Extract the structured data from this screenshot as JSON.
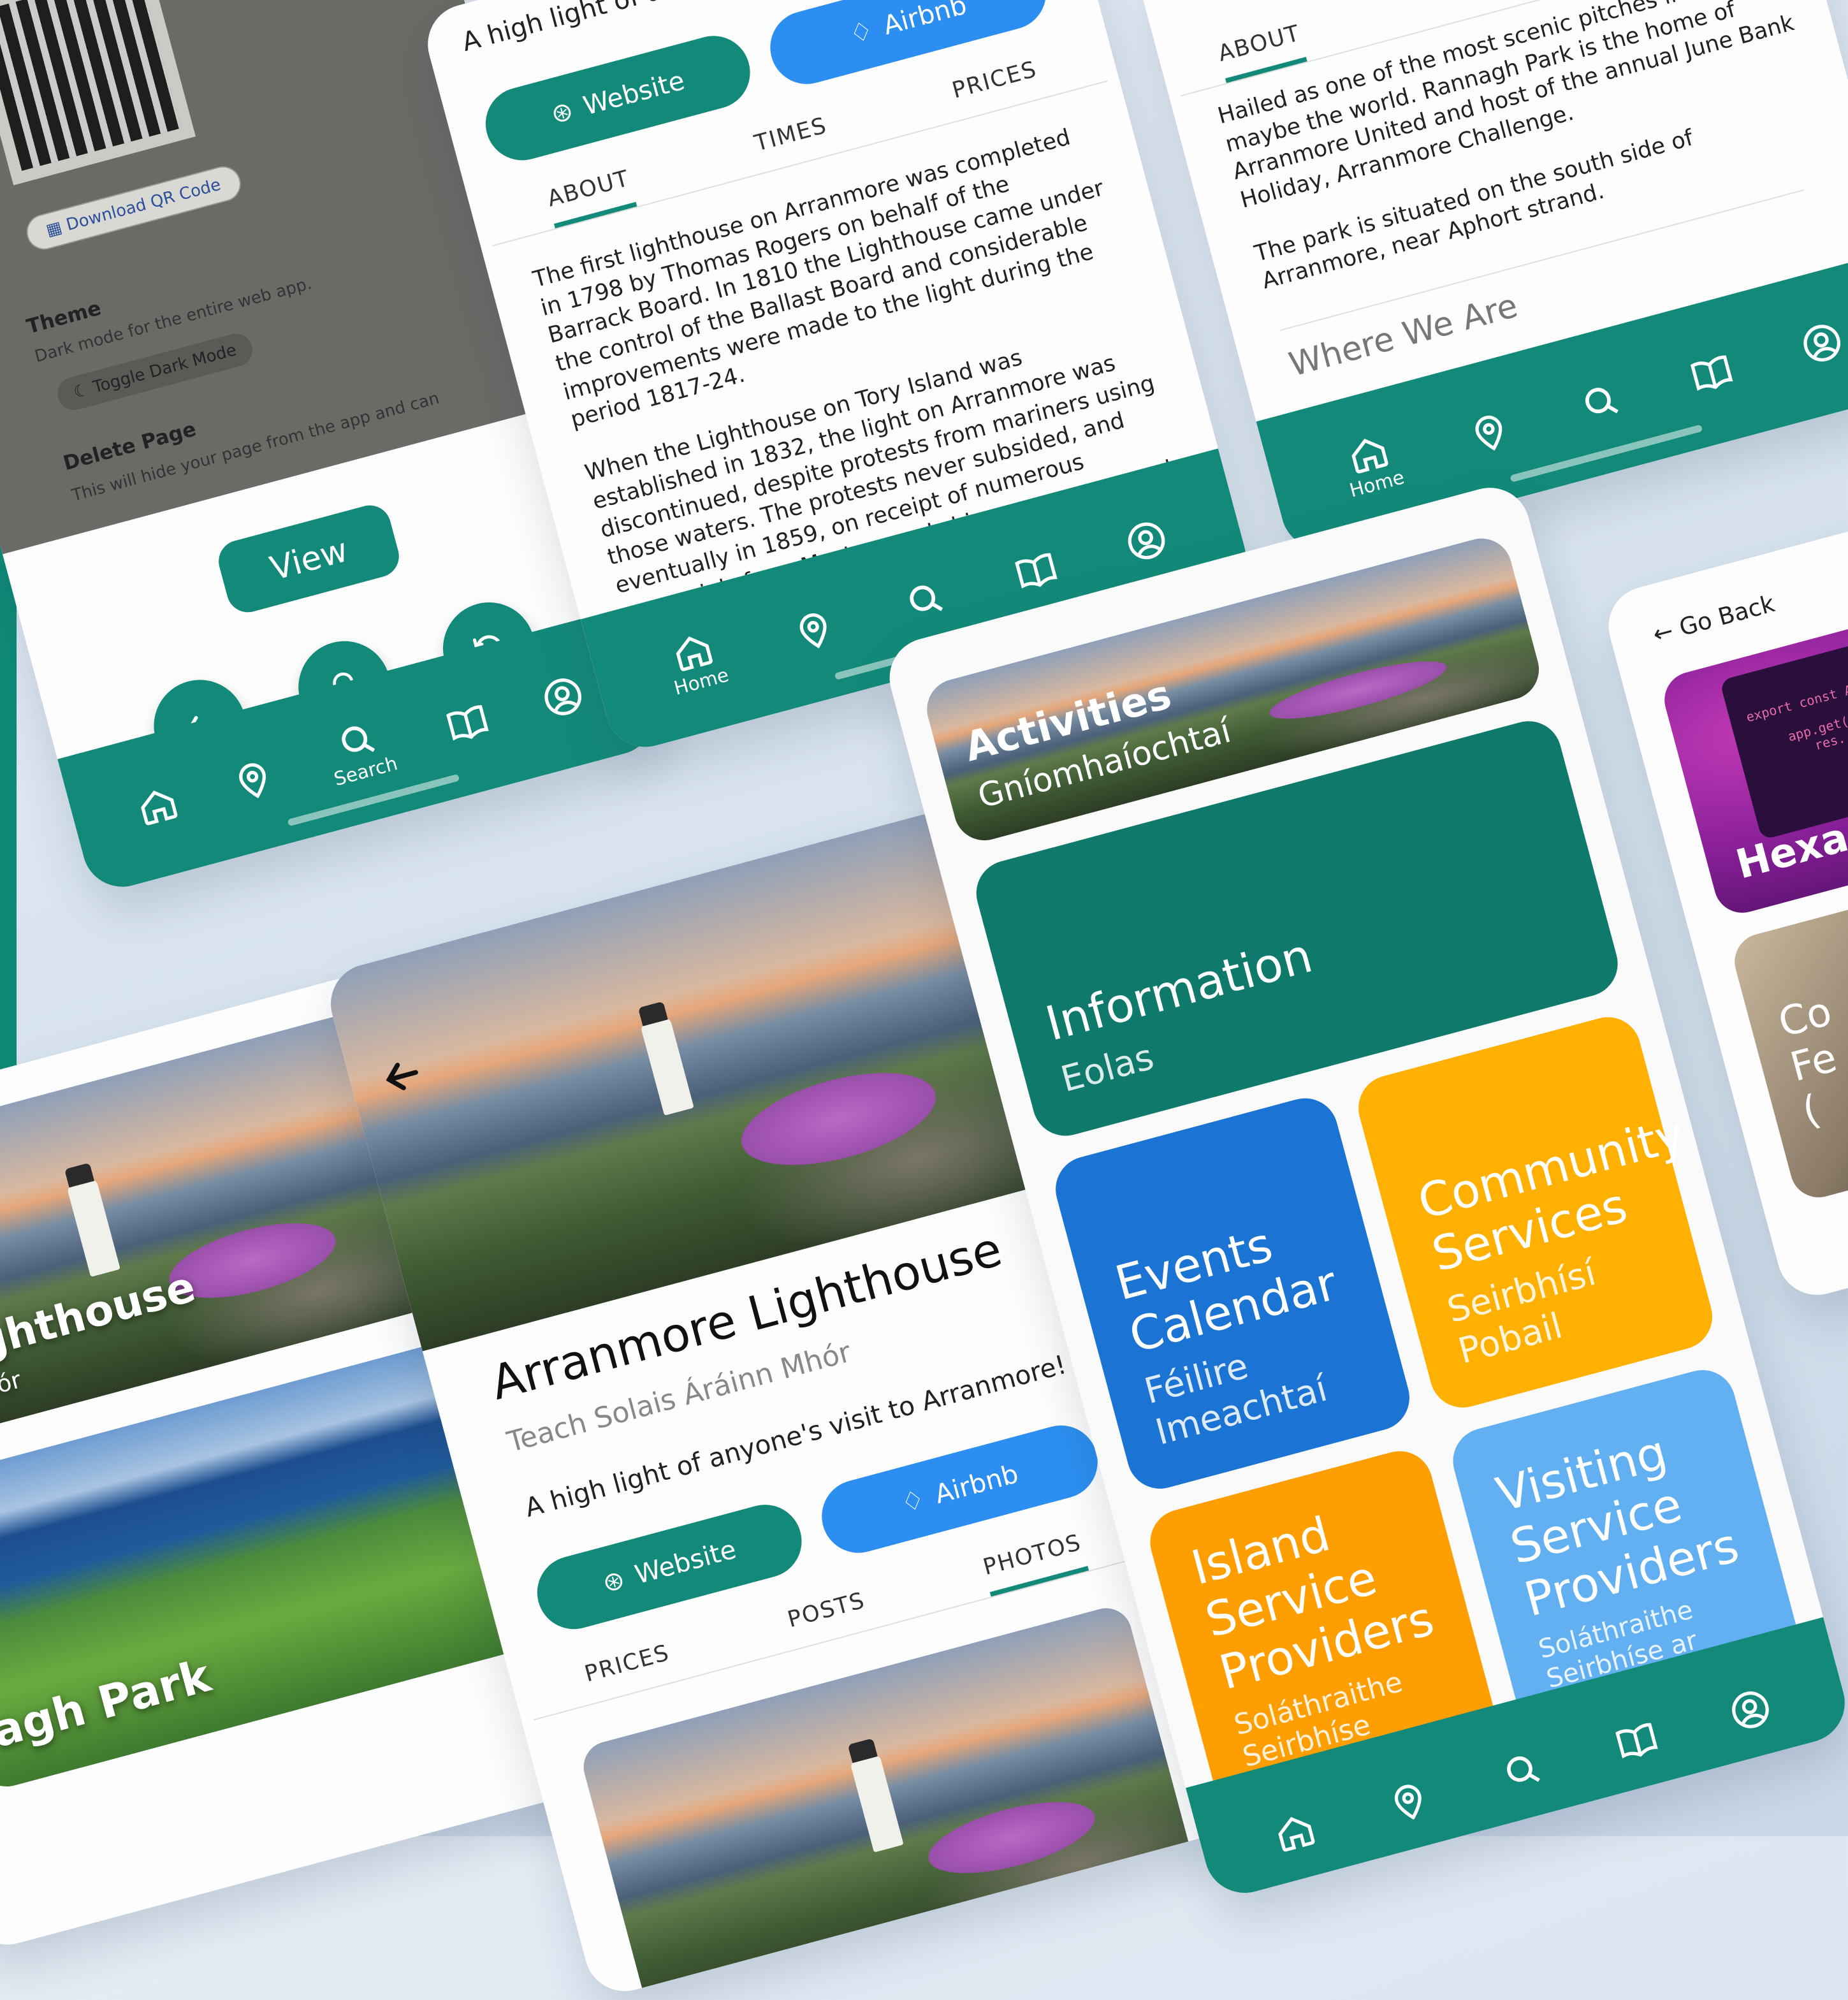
{
  "settings_screen": {
    "download_qr": "Download QR Code",
    "theme_title": "Theme",
    "theme_desc": "Dark mode for the entire web app.",
    "toggle_dark": "Toggle Dark Mode",
    "delete_title": "Delete Page",
    "delete_desc": "This will hide your page from the app and can",
    "view_button": "View",
    "nav_search_label": "Search"
  },
  "lighthouse_about_screen": {
    "tagline": "A high light of anyone's visit to Arranmore!",
    "website_button": "Website",
    "airbnb_button": "Airbnb",
    "tabs": [
      "ABOUT",
      "TIMES",
      "PRICES"
    ],
    "paragraph_1": "The first lighthouse on Arranmore was completed in 1798 by Thomas Rogers on behalf of the Barrack Board. In 1810 the Lighthouse came under the control of the Ballast Board and considerable improvements were made to the light during the period 1817-24.",
    "paragraph_2": "When the Lighthouse on Tory Island was established in 1832, the light on Arranmore was discontinued, despite protests from mariners using those waters. The protests never subsided, and eventually in 1859, on receipt of numerous memorials from Masters and shipowners, approval was granted for the re-establishment of the Arranmore Light.",
    "nav_home_label": "Home"
  },
  "park_about_screen": {
    "tab_about": "ABOUT",
    "paragraph_1": "Hailed as one of the most scenic pitches in Ireland, maybe the world. Rannagh Park is the home of Arranmore United and host of the annual June Bank Holiday, Arranmore Challenge.",
    "paragraph_2": "The park is situated on the south side of Arranmore, near Aphort strand.",
    "where_we_are": "Where We Are",
    "nav_home_label": "Home"
  },
  "list_screen": {
    "card_1_title": "e Lighthouse",
    "card_1_subtitle": "ainn Mhór",
    "card_2_title": "agh Park"
  },
  "detail_screen": {
    "title": "Arranmore Lighthouse",
    "subtitle": "Teach Solais Áráinn Mhór",
    "tagline": "A high light of anyone's visit to Arranmore!",
    "website_button": "Website",
    "airbnb_button": "Airbnb",
    "tabs": [
      "PRICES",
      "POSTS",
      "PHOTOS"
    ]
  },
  "menu_screen": {
    "activities_title": "Activities",
    "activities_subtitle": "Gníomhaíochtaí",
    "tiles": [
      {
        "title": "Information",
        "subtitle": "Eolas",
        "color": "#0f7a6b"
      },
      {
        "title": "Events Calendar",
        "subtitle": "Féilire Imeachtaí",
        "color": "#1b73d3"
      },
      {
        "title": "Community Services",
        "subtitle": "Seirbhísí Pobail",
        "color": "#ffb000"
      },
      {
        "title": "Island Service Providers",
        "subtitle": "Soláthraithe Seirbhíse Oileán",
        "color": "#ff9e00"
      },
      {
        "title": "Visiting Service Providers",
        "subtitle": "Soláthraithe Seirbhíse ar Cuairt",
        "color": "#62b0f2"
      }
    ]
  },
  "right_screen": {
    "go_back": "Go Back",
    "code_line_1": "export const A",
    "code_line_2": "app.get(",
    "code_line_3": "res.",
    "card_title": "Hexa",
    "card_2_text": "Co\nFe\n("
  },
  "colors": {
    "primary": "#138a79",
    "airbnb_blue": "#2b8ef0"
  }
}
